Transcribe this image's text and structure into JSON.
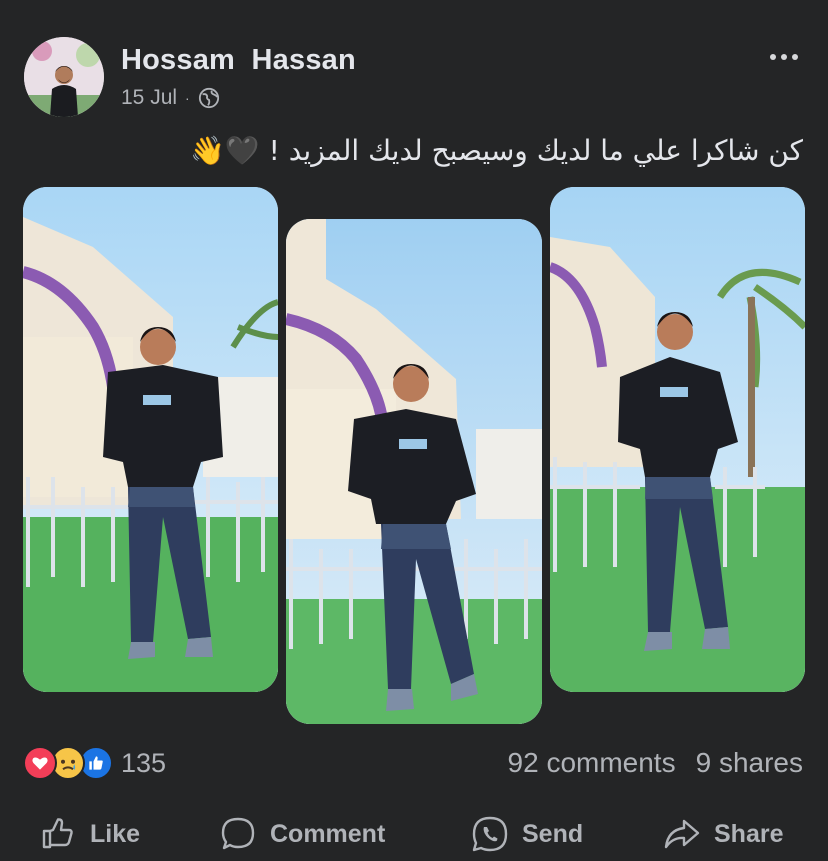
{
  "post": {
    "author": "Hossam  Hassan",
    "date": "15 Jul",
    "separator": "·",
    "privacy_icon": "globe-icon",
    "more_icon": "more-horizontal-icon",
    "caption": "كن شاكرا علي ما لديك وسيصبح لديك المزيد ! 🖤👋"
  },
  "photos": [
    {
      "name": "photo-1",
      "subject": "man-standing-black-tshirt-jeans"
    },
    {
      "name": "photo-2",
      "subject": "man-standing-looking-side"
    },
    {
      "name": "photo-3",
      "subject": "man-standing-smiling"
    }
  ],
  "engagement": {
    "reaction_icons": [
      "love-icon",
      "sad-icon",
      "like-icon"
    ],
    "reaction_count": "135",
    "comments": "92 comments",
    "shares": "9 shares"
  },
  "actions": {
    "like": "Like",
    "comment": "Comment",
    "send": "Send",
    "share": "Share"
  },
  "colors": {
    "background": "#242526",
    "text_primary": "#e4e6eb",
    "text_secondary": "#b0b3b8",
    "love": "#f33e58",
    "like": "#1b74e4",
    "sad": "#f7c548"
  }
}
